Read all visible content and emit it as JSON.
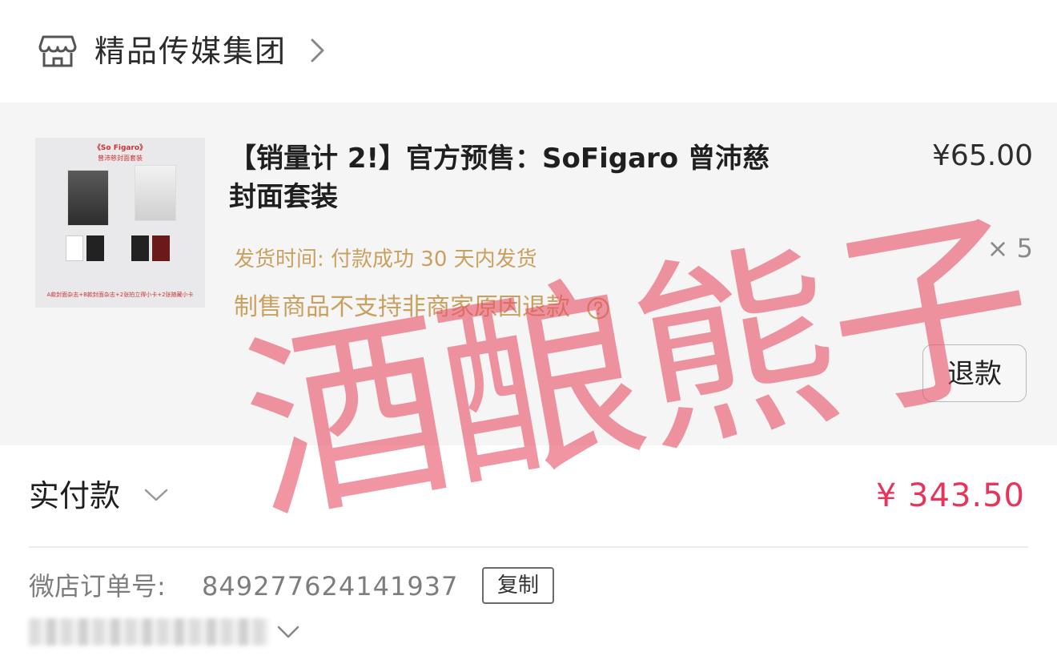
{
  "header": {
    "shop_icon": "shop-icon",
    "shop_name": "精品传媒集团",
    "chevron_icon": "chevron-right-icon"
  },
  "product": {
    "thumbnail": {
      "title": "《So Figaro》",
      "subtitle": "曾沛慈封面套装",
      "bottom_text": "A款封面杂志+B款封面杂志+2张拍立得小卡+2张随藏小卡"
    },
    "title": "【销量计 2!】官方预售：SoFigaro 曾沛慈封面套装",
    "price": "¥65.00",
    "quantity": "× 5",
    "shipping": "发货时间: 付款成功 30 天内发货",
    "policy": "制售商品不支持非商家原因退款",
    "help_icon": "question-circle-icon",
    "refund_label": "退款"
  },
  "payment": {
    "label": "实付款",
    "chevron_icon": "chevron-down-icon",
    "amount": "¥ 343.50"
  },
  "order": {
    "label": "微店订单号:",
    "number": "849277624141937",
    "copy_label": "复制",
    "expand_icon": "chevron-down-icon"
  },
  "watermark": {
    "text": "酒酿熊子"
  },
  "colors": {
    "accent_price": "#e8335a",
    "notice_gold": "#c9a15f",
    "watermark": "#e84e64",
    "card_bg": "#f5f5f5"
  }
}
